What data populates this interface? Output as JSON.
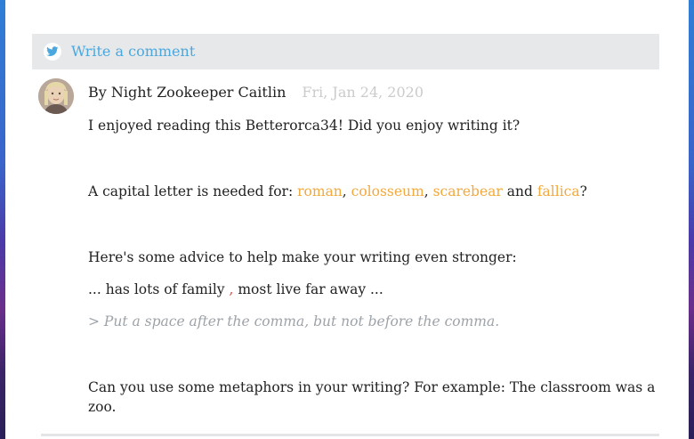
{
  "comment_bar": {
    "icon": "bird-icon",
    "label": "Write a comment"
  },
  "comment": {
    "avatar_icon": "avatar",
    "author": "By Night Zookeeper Caitlin",
    "date": "Fri, Jan 24, 2020",
    "line1": "I enjoyed reading this Betterorca34! Did you enjoy writing it?",
    "capital": {
      "prefix": "A capital letter is needed for: ",
      "word1": "roman",
      "sep1": ", ",
      "word2": "colosseum",
      "sep2": ", ",
      "word3": "scarebear",
      "sep3": " and ",
      "word4": "fallica",
      "suffix": "?"
    },
    "advice_intro": "Here's some advice to help make your writing even stronger:",
    "example": {
      "before": "... has lots of family ",
      "mark": ",",
      "after": " most live far away ..."
    },
    "hint": "> Put a space after the comma, but not before the comma.",
    "metaphor": "Can you use some metaphors in your writing? For example: The classroom was a zoo."
  },
  "colors": {
    "accent_link": "#4aa8de",
    "highlight": "#f3a93b",
    "error_mark": "#e0473b",
    "hint": "#9ea3a8",
    "date": "#c9cbcd"
  }
}
